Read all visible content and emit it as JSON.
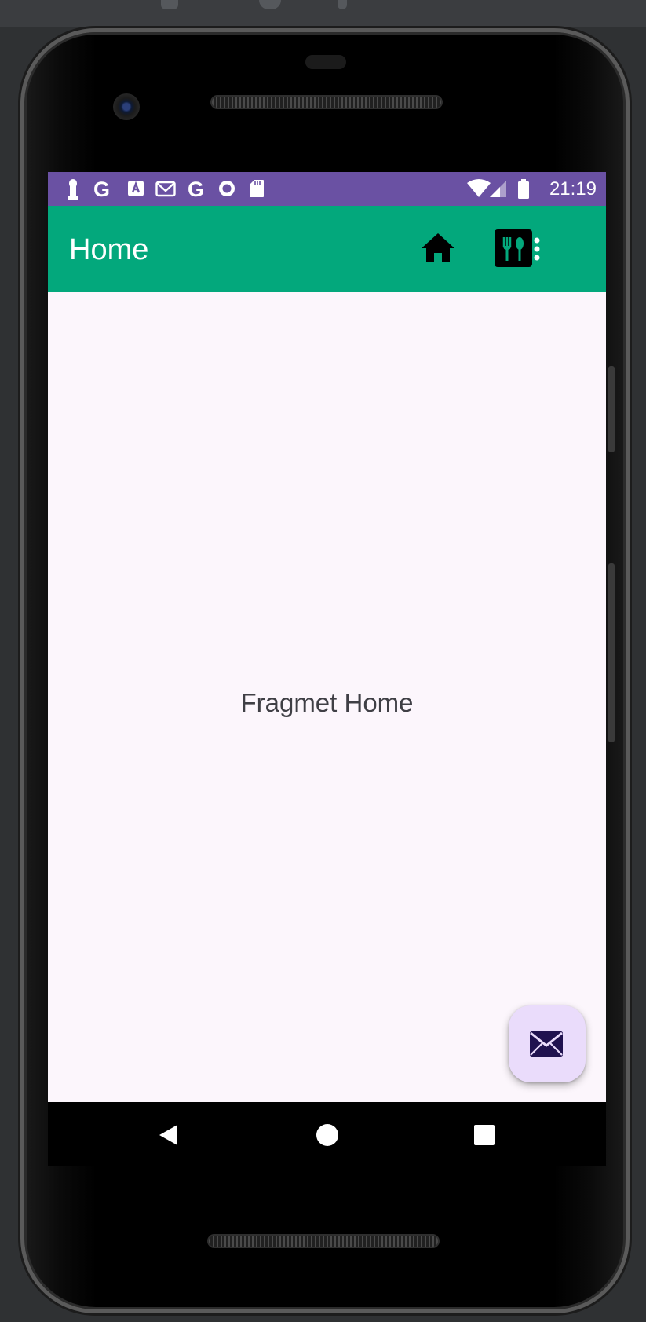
{
  "status_bar": {
    "time": "21:19",
    "left_icons": [
      "key-icon",
      "google-icon",
      "accessibility-icon",
      "gmail-icon",
      "google-icon",
      "circle-icon",
      "sd-card-icon"
    ],
    "right_icons": [
      "wifi-icon",
      "signal-icon",
      "battery-icon"
    ],
    "color": "#6a51a3"
  },
  "app_bar": {
    "title": "Home",
    "color": "#03a87c",
    "actions": [
      "home-icon",
      "restaurant-icon",
      "overflow-menu-icon"
    ]
  },
  "content": {
    "text": "Fragmet Home",
    "background": "#fcf6fc"
  },
  "fab": {
    "icon": "email-icon",
    "color": "#eadcfb"
  },
  "nav_bar": {
    "buttons": [
      "back-button",
      "home-button",
      "recents-button"
    ]
  }
}
